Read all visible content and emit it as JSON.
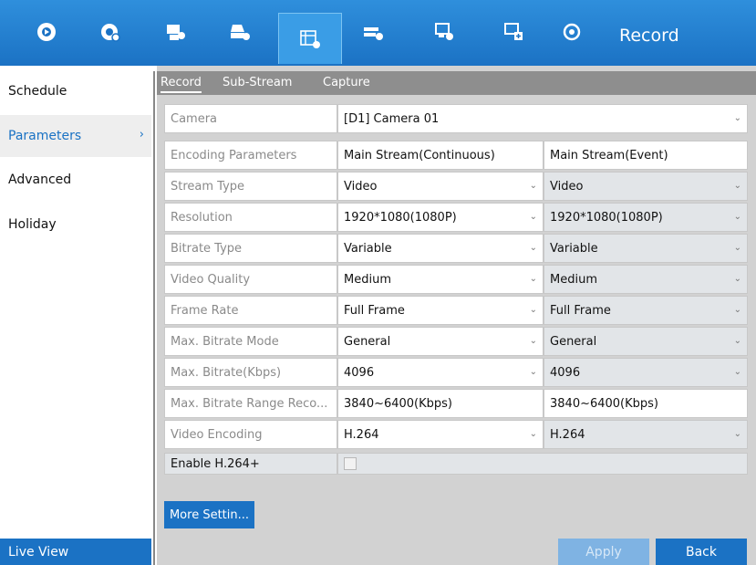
{
  "topbar": {
    "title": "Record",
    "icons": [
      "live-view-icon",
      "playback-icon",
      "camera-config-icon",
      "storage-config-icon",
      "record-config-icon",
      "network-config-icon",
      "system-config-icon",
      "system-maintenance-icon",
      "shutdown-icon"
    ],
    "active_icon": "record-config-icon"
  },
  "sidebar": {
    "items": [
      {
        "label": "Schedule"
      },
      {
        "label": "Parameters",
        "chevron": "›"
      },
      {
        "label": "Advanced"
      },
      {
        "label": "Holiday"
      }
    ],
    "active": "Parameters",
    "live_view": "Live View"
  },
  "tabs": [
    {
      "label": "Record"
    },
    {
      "label": "Sub-Stream"
    },
    {
      "label": "Capture"
    }
  ],
  "active_tab": "Record",
  "camera": {
    "label": "Camera",
    "value": "[D1] Camera 01"
  },
  "table": {
    "header": {
      "label": "Encoding Parameters",
      "col1": "Main Stream(Continuous)",
      "col2": "Main Stream(Event)"
    },
    "rows": [
      {
        "label": "Stream Type",
        "col1": "Video",
        "col2": "Video"
      },
      {
        "label": "Resolution",
        "col1": "1920*1080(1080P)",
        "col2": "1920*1080(1080P)"
      },
      {
        "label": "Bitrate Type",
        "col1": "Variable",
        "col2": "Variable"
      },
      {
        "label": "Video Quality",
        "col1": "Medium",
        "col2": "Medium"
      },
      {
        "label": "Frame Rate",
        "col1": "Full Frame",
        "col2": "Full Frame"
      },
      {
        "label": "Max. Bitrate Mode",
        "col1": "General",
        "col2": "General"
      },
      {
        "label": "Max. Bitrate(Kbps)",
        "col1": "4096",
        "col2": "4096"
      },
      {
        "label": "Max. Bitrate Range Reco...",
        "col1": "3840~6400(Kbps)",
        "col2": "3840~6400(Kbps)"
      },
      {
        "label": "Video Encoding",
        "col1": "H.264",
        "col2": "H.264"
      }
    ]
  },
  "enable_h264plus": {
    "label": "Enable H.264+",
    "checked": false
  },
  "buttons": {
    "more_settings": "More Settin...",
    "apply": "Apply",
    "back": "Back"
  },
  "dropdown_arrow": "⌄",
  "colors": {
    "accent": "#1b72c4",
    "panel_bg": "#d2d2d2",
    "tab_bar": "#8e8e8e"
  }
}
